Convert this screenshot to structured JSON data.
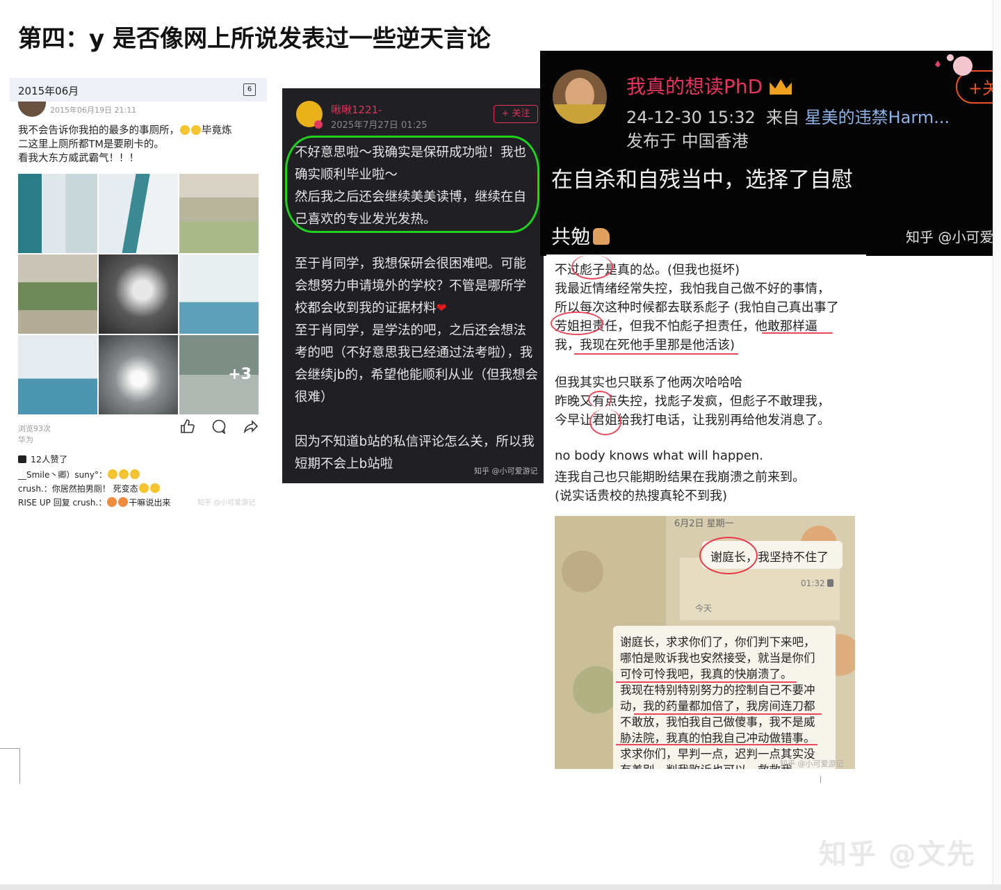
{
  "heading": "第四：y 是否像网上所说发表过一些逆天言论",
  "qzone_post": {
    "month_label": "2015年06月",
    "calendar_icon_text": "6",
    "post_date": "2015年06月19日 21:11",
    "text_lines": [
      "我不会告诉你我拍的最多的事厕所，",
      "毕竟炼",
      "二这里上厕所都TM是要刷卡的。",
      "看我大东方威武霸气！！！"
    ],
    "more_photos": "+3",
    "views": "浏览93次",
    "device": "华为",
    "likes": "12人赞了",
    "comments": [
      "__Smile丶卿）suny°：",
      "crush.：你居然拍男厕！ 死变态",
      "RISE UP 回复 crush.：",
      "干嘛说出来"
    ],
    "watermark": "知乎 @小可爱游记"
  },
  "bili_post": {
    "username": "啾啾1221-",
    "timestamp": "2025年7月27日 01:25",
    "follow_label": "+ 关注",
    "highlighted_lines": [
      "不好意思啦～我确实是保研成功啦！我也",
      "确实顺利毕业啦～",
      "然后我之后还会继续美美读博，继续在自",
      "己喜欢的专业发光发热。"
    ],
    "body_lines": [
      "至于肖同学，我想保研会很困难吧。可能",
      "会想努力申请境外的学校？不管是哪所学",
      "校都会收到我的证据材料",
      "至于肖同学，是学法的吧，之后还会想法",
      "考的吧（不好意思我已经通过法考啦），我",
      "会继续jb的，希望他能顺利从业（但我想会",
      "很难）",
      "因为不知道b站的私信评论怎么关，所以我",
      "短期不会上b站啦"
    ],
    "watermark": "知乎 @小可爱游记"
  },
  "phd_post": {
    "username": "我真的想读PhD",
    "time": "24-12-30 15:32",
    "from_label": "来自",
    "from_source": "星美的违禁Harm...",
    "location": "发布于 中国香港",
    "body": "在自杀和自残当中，选择了自慰",
    "footer": "共勉",
    "follow_label": "+关",
    "watermark": "知乎 @小可爱"
  },
  "text_post": {
    "lines": [
      "不过彪子是真的怂。(但我也挺坏)",
      "我最近情绪经常失控，我怕我自己做不好的事情，",
      "所以每次这种时候都去联系彪子 (我怕自己真出事了",
      "芳姐担责任，但我不怕彪子担责任，他敢那样逼",
      "我，我现在死他手里那是他活该)",
      "",
      "但我其实也只联系了他两次哈哈哈",
      "昨晚又有点失控，找彪子发疯，但彪子不敢理我，",
      "今早让君姐给我打电话，让我别再给他发消息了。",
      "",
      "no body knows what will happen.",
      "连我自己也只能期盼结果在我崩溃之前来到。",
      "(说实话贵校的热搜真轮不到我)"
    ]
  },
  "chat": {
    "date_header": "6月2日 星期一",
    "bubble1": "谢庭长，我坚持不住了",
    "time1": "01:32",
    "today_label": "今天",
    "bubble2_lines": [
      "谢庭长，求求你们了，你们判下来吧，",
      "哪怕是败诉我也安然接受，就当是你们",
      "可怜可怜我吧，我真的快崩溃了。",
      "我现在特别特别努力的控制自己不要冲",
      "动，我的药量都加倍了，我房间连刀都",
      "不敢放，我怕我自己做傻事，我不是威",
      "胁法院，我真的怕我自己冲动做错事。",
      "求求你们，早判一点，迟判一点其实没",
      "有差别，判我败诉也可以，救救我"
    ],
    "watermark": "知乎 @小可爱游记"
  },
  "page_watermark": "知乎 @文先",
  "colors": {
    "highlight_green": "#1ed21e",
    "pen_red": "#e8485a",
    "bili_pink": "#e0345a"
  }
}
